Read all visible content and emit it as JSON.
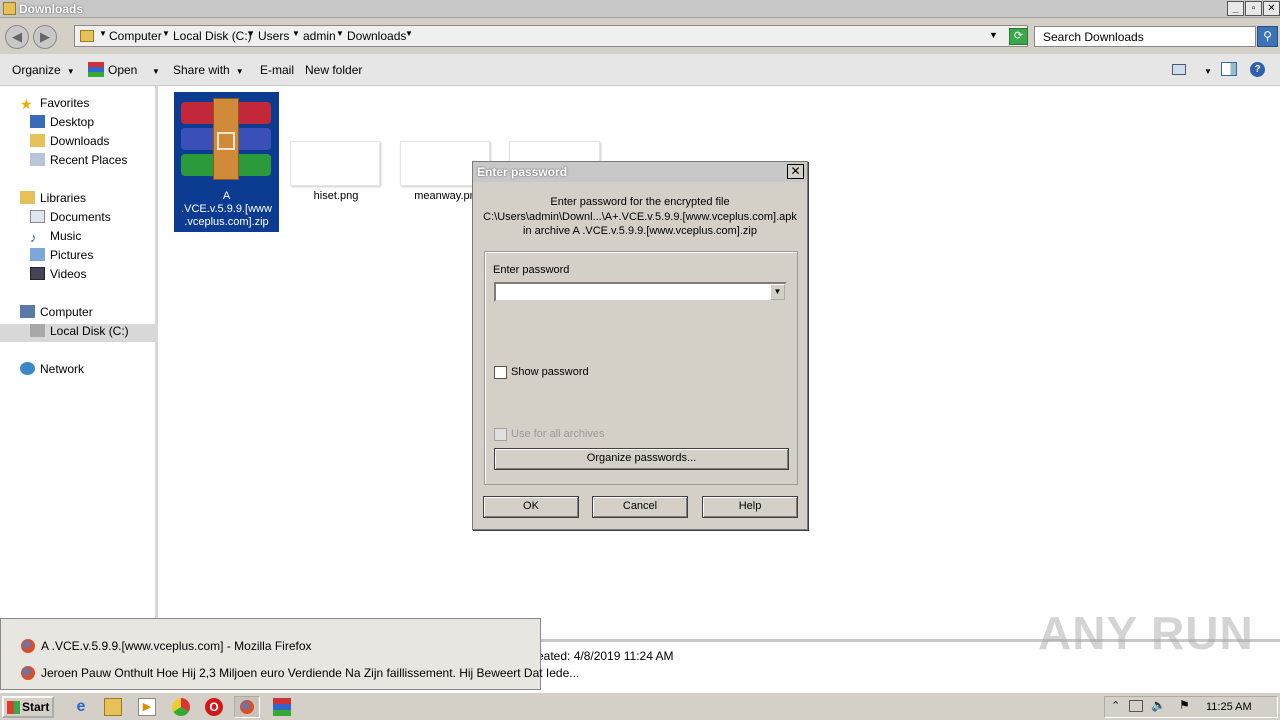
{
  "window": {
    "title": "Downloads"
  },
  "address": {
    "crumbs": [
      "Computer",
      "Local Disk (C:)",
      "Users",
      "admin",
      "Downloads"
    ],
    "search_placeholder": "Search Downloads"
  },
  "toolbar": {
    "organize": "Organize",
    "open": "Open",
    "share_with": "Share with",
    "email": "E-mail",
    "new_folder": "New folder"
  },
  "nav": {
    "favorites": "Favorites",
    "desktop": "Desktop",
    "downloads": "Downloads",
    "recent_places": "Recent Places",
    "libraries": "Libraries",
    "documents": "Documents",
    "music": "Music",
    "pictures": "Pictures",
    "videos": "Videos",
    "computer": "Computer",
    "local_disk": "Local Disk (C:)",
    "network": "Network"
  },
  "files": [
    {
      "name_line1": "A",
      "name_line2": ".VCE.v.5.9.9.[www",
      "name_line3": ".vceplus.com].zip"
    },
    {
      "name": "hiset.png"
    },
    {
      "name": "meanway.pn"
    }
  ],
  "details": {
    "created": "eated: 4/8/2019 11:24 AM"
  },
  "dialog": {
    "title": "Enter password",
    "line1": "Enter password for the encrypted file",
    "line2": "C:\\Users\\admin\\Downl...\\A+.VCE.v.5.9.9.[www.vceplus.com].apk",
    "line3": "in archive A .VCE.v.5.9.9.[www.vceplus.com].zip",
    "enter_password_label": "Enter password",
    "password_value": "",
    "show_password": "Show password",
    "use_for_all": "Use for all archives",
    "organize_passwords": "Organize passwords...",
    "ok": "OK",
    "cancel": "Cancel",
    "help": "Help"
  },
  "taskbar_popup": {
    "item1": "A .VCE.v.5.9.9.[www.vceplus.com] - Mozilla Firefox",
    "item2": "Jeroen Pauw Onthult Hoe Hij 2,3 Miljoen euro Verdiende Na Zijn faillissement. Hij Beweert Dat Iede..."
  },
  "taskbar": {
    "start": "Start",
    "clock": "11:25 AM"
  },
  "watermark": "ANY RUN"
}
